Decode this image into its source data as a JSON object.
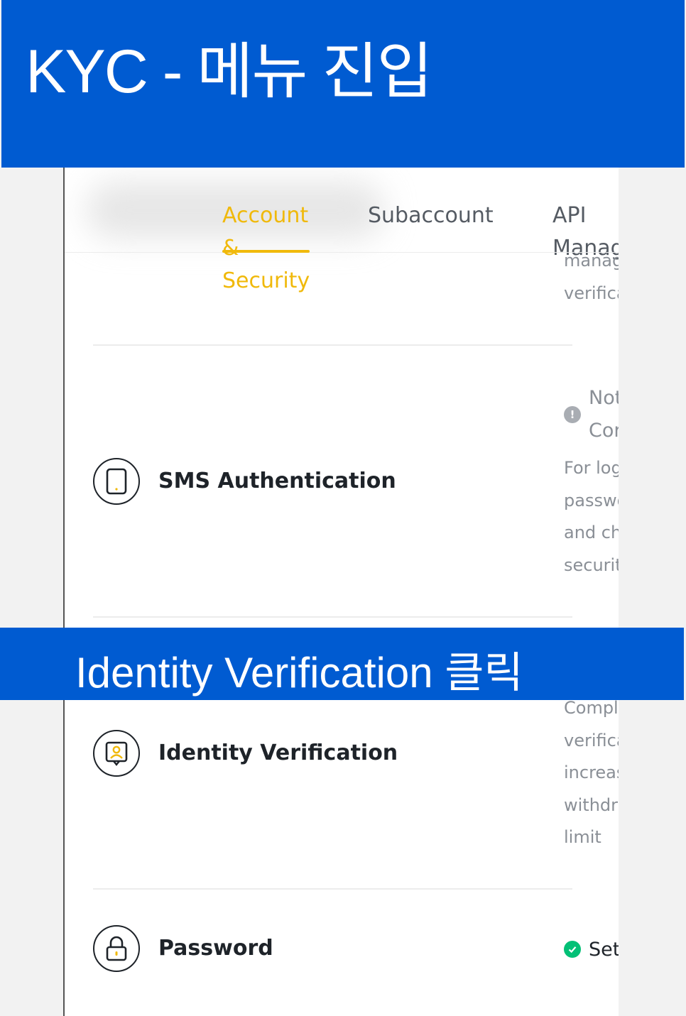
{
  "banner": {
    "title": "KYC - 메뉴 진입"
  },
  "tabs": [
    {
      "label": "Account & Security",
      "active": true
    },
    {
      "label": "Subaccount",
      "active": false
    },
    {
      "label": "API Manag",
      "active": false
    }
  ],
  "top_desc": [
    "manag",
    "verifica"
  ],
  "rows": {
    "sms": {
      "label": "SMS Authentication",
      "status_icon": "exclamation-icon",
      "status_lines": [
        "Not",
        "Cor"
      ],
      "desc": [
        "For log",
        "passwo",
        "and cha",
        "securit"
      ]
    },
    "identity": {
      "label": "Identity Verification",
      "desc": [
        "Comple",
        "verifica",
        "increas",
        "withdra",
        "limit"
      ]
    },
    "password": {
      "label": "Password",
      "status_icon": "check-icon",
      "status": "Set"
    }
  },
  "caption": {
    "text": "Identity Verification 클릭"
  },
  "colors": {
    "banner_blue": "#005bd1",
    "accent": "#f0b90b",
    "success": "#02c076",
    "warning_grey": "#a9adb3"
  }
}
